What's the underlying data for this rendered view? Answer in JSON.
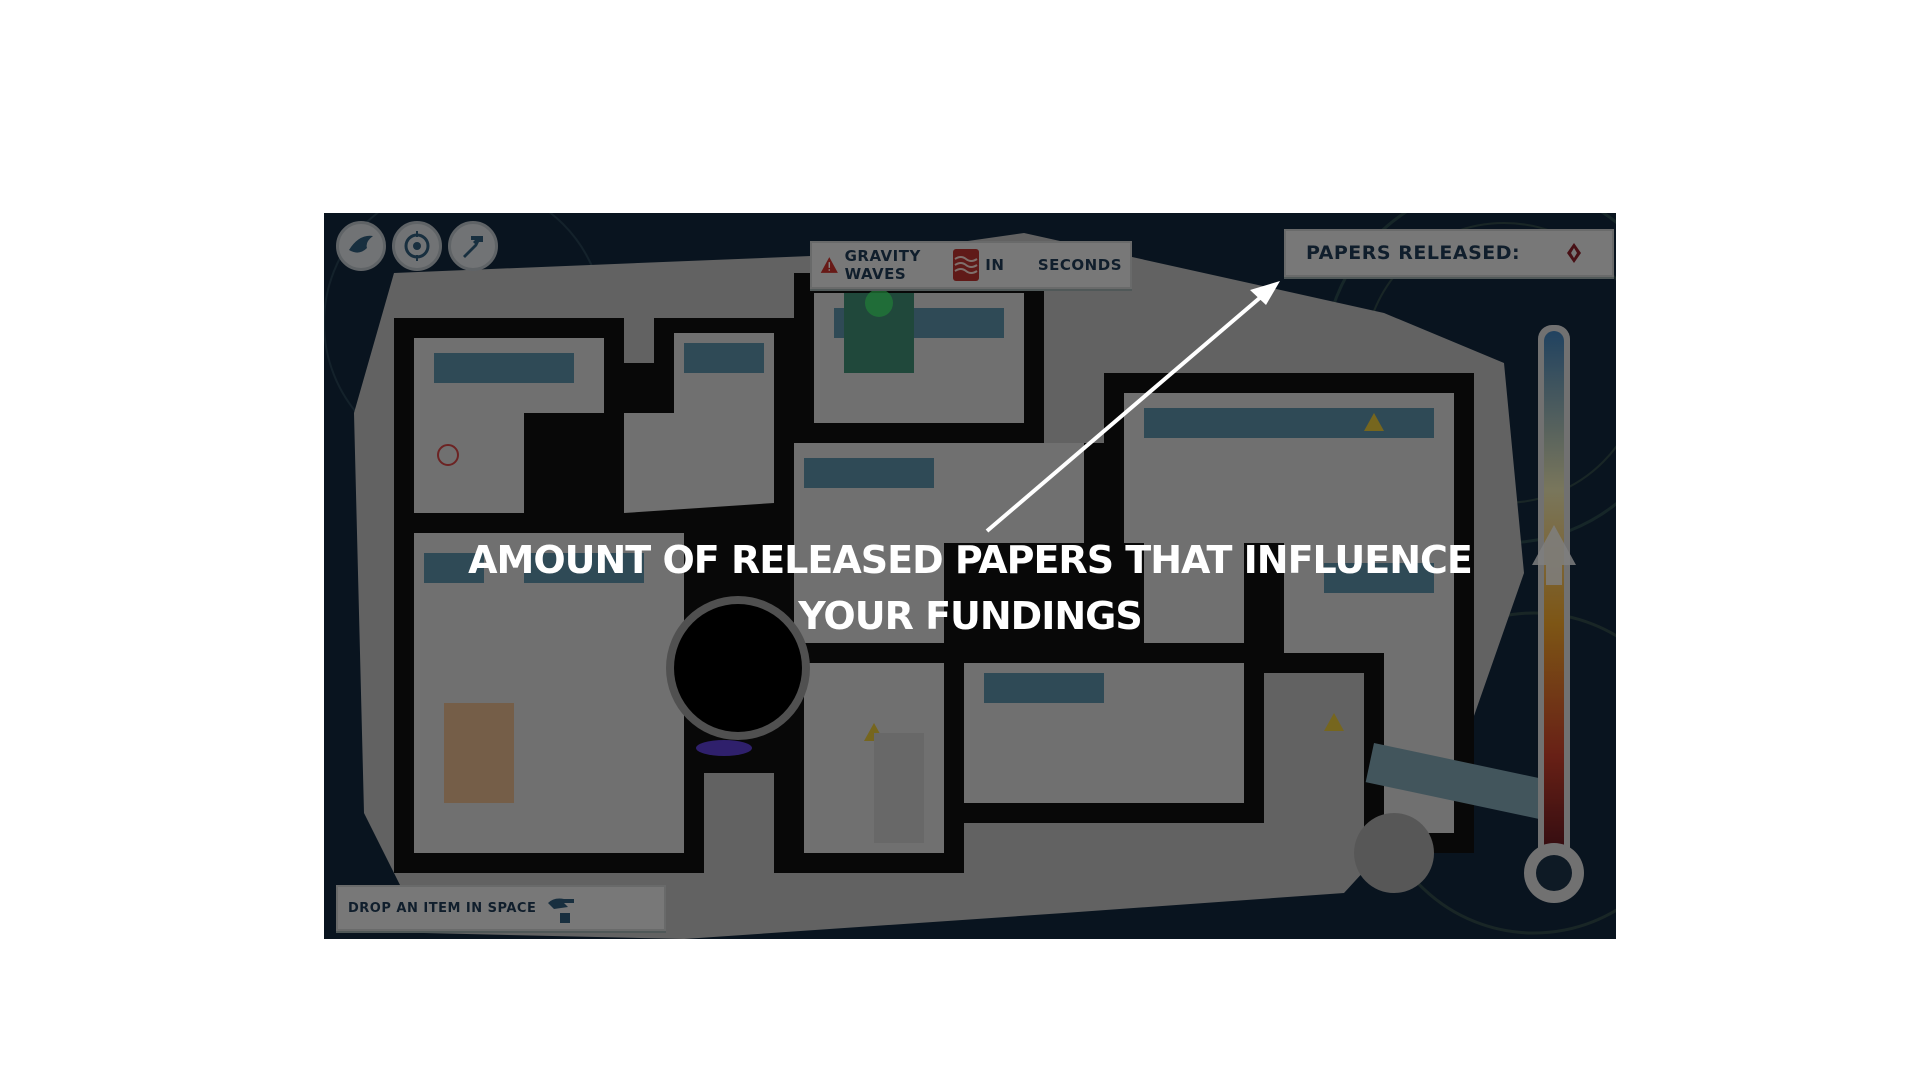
{
  "toolbar": {
    "buttons": [
      {
        "icon": "bird-icon"
      },
      {
        "icon": "target-icon"
      },
      {
        "icon": "hammer-icon"
      }
    ]
  },
  "gravity_banner": {
    "label": "GRAVITY WAVES",
    "in": "IN",
    "seconds": "SECONDS",
    "warning_icon": "warning-icon",
    "wave_icon": "gravity-waves-icon"
  },
  "papers_banner": {
    "label": "PAPERS RELEASED:",
    "icon": "diamond-icon"
  },
  "drop_banner": {
    "label": "DROP AN ITEM IN SPACE",
    "icon": "drop-hand-icon"
  },
  "annotation": {
    "line1": "AMOUNT OF RELEASED PAPERS THAT INFLUENCE",
    "line2": "YOUR FUNDINGS"
  },
  "colors": {
    "banner_text": "#1f3b55",
    "warning": "#c8332c",
    "space": "#0f2235"
  }
}
